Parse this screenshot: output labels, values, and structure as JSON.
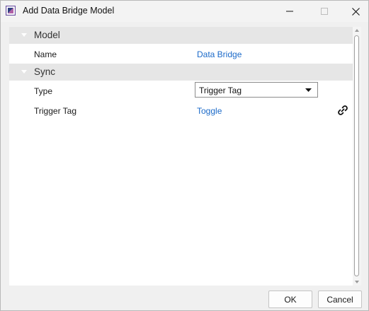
{
  "window": {
    "title": "Add Data Bridge Model"
  },
  "groups": [
    {
      "label": "Model",
      "properties": [
        {
          "label": "Name",
          "value": "Data Bridge"
        }
      ]
    },
    {
      "label": "Sync",
      "properties": [
        {
          "label": "Type",
          "value": "Trigger Tag"
        },
        {
          "label": "Trigger Tag",
          "value": "Toggle"
        }
      ]
    }
  ],
  "buttons": {
    "ok": "OK",
    "cancel": "Cancel"
  },
  "icons": {
    "app": "app-logo-icon",
    "link": "link-icon",
    "collapse": "triangle-down-icon"
  },
  "colors": {
    "link": "#1b6ac9",
    "group_header_bg": "#e6e6e6"
  }
}
